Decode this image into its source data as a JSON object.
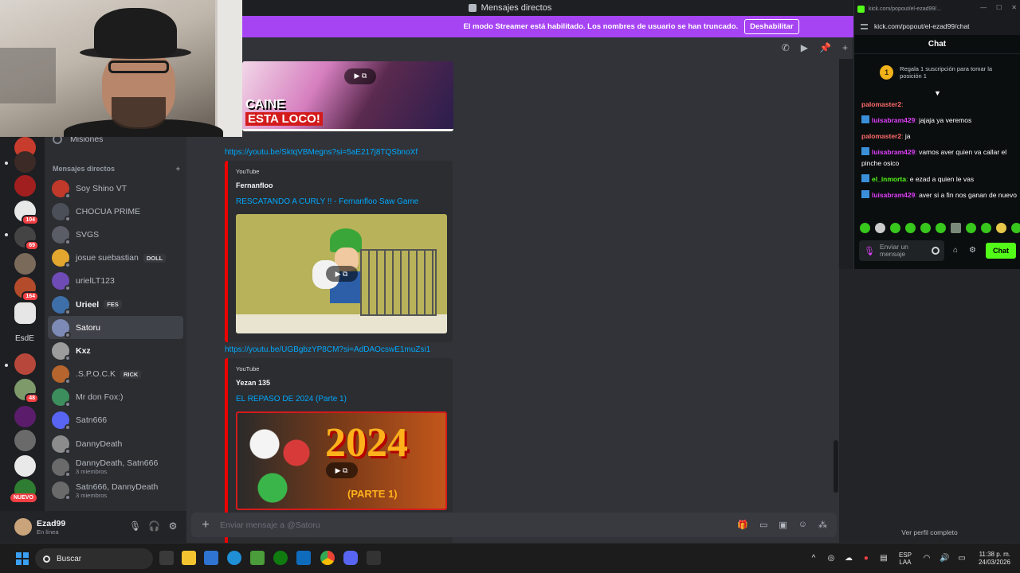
{
  "titlebar": {
    "title": "Mensajes directos"
  },
  "banner": {
    "text": "El modo Streamer está habilitado. Los nombres de usuario se han truncado.",
    "button": "Deshabilitar"
  },
  "rail": {
    "label": "EsdE",
    "badges": [
      "104",
      "69",
      "164",
      "48"
    ],
    "nuevo": "NUEVO"
  },
  "sidebar": {
    "misiones": "Misiones",
    "dm_header": "Mensajes directos",
    "add": "+",
    "items": [
      {
        "name": "Soy Shino VT",
        "tag": "",
        "sub": "",
        "color": "#c0392b"
      },
      {
        "name": "CHOCUA PRIME",
        "tag": "",
        "sub": "",
        "color": "#4b4f58"
      },
      {
        "name": "SVGS",
        "tag": "",
        "sub": "",
        "color": "#5a5d66"
      },
      {
        "name": "josue suebastian",
        "tag": "DOLL",
        "sub": "",
        "color": "#e3a72f"
      },
      {
        "name": "urielLT123",
        "tag": "",
        "sub": "",
        "color": "#6f4bb5"
      },
      {
        "name": "Urieel",
        "tag": "FES",
        "sub": "",
        "color": "#3f6fa8"
      },
      {
        "name": "Satoru",
        "tag": "",
        "sub": "",
        "color": "#7d8ab5"
      },
      {
        "name": "Kxz",
        "tag": "",
        "sub": "",
        "color": "#9c9c9c"
      },
      {
        "name": ".S.P.O.C.K",
        "tag": "RICK",
        "sub": "",
        "color": "#b5652d"
      },
      {
        "name": "Mr don Fox:)",
        "tag": "",
        "sub": "",
        "color": "#3c8e5c"
      },
      {
        "name": "Satn666",
        "tag": "",
        "sub": "",
        "color": "#5865f2"
      },
      {
        "name": "DannyDeath",
        "tag": "",
        "sub": "",
        "color": "#8c8c8c"
      },
      {
        "name": "DannyDeath, Satn666",
        "tag": "",
        "sub": "3 miembros",
        "color": "#6a6a6a"
      },
      {
        "name": "Satn666, DannyDeath",
        "tag": "",
        "sub": "3 miembros",
        "color": "#6a6a6a"
      }
    ],
    "active_index": 6
  },
  "user": {
    "name": "Ezad99",
    "status": "En línea"
  },
  "chat": {
    "link1": "https://youtu.be/SktqVBMegns?si=5aE217j8TQSbnoXf",
    "embed1": {
      "provider": "YouTube",
      "author": "Fernanfloo",
      "title": "RESCATANDO A CURLY !! - Fernanfloo Saw Game",
      "thumb_color": "#b8b25a"
    },
    "top_thumb": {
      "text1": "CAINE",
      "text2": "ESTA LOCO!"
    },
    "link2": "https://youtu.be/UGBgbzYP8CM?si=AdDAOcswE1muZsi1",
    "embed2": {
      "provider": "YouTube",
      "author": "Yezan 135",
      "title": "EL REPASO DE 2024 (Parte 1)",
      "big": "2024",
      "small": "(PARTE 1)"
    },
    "composer_placeholder": "Enviar mensaje a @Satoru"
  },
  "profile": {
    "link": "Ver perfil completo"
  },
  "kick": {
    "window_title": "kick.com/popout/el-ezad99/...",
    "url": "kick.com/popout/el-ezad99/chat",
    "header": "Chat",
    "gift_text": "Regala 1 suscripción para tomar la posición 1",
    "gift_rank": "1",
    "messages": [
      {
        "user": "palomaster2",
        "text": "",
        "color": "#ff6b6b",
        "badge": false
      },
      {
        "user": "luisabram429",
        "text": "jajaja ya veremos",
        "color": "#e040fb",
        "badge": true
      },
      {
        "user": "palomaster2",
        "text": "ja",
        "color": "#ff6b6b",
        "badge": false
      },
      {
        "user": "luisabram429",
        "text": "vamos aver quien va callar el pinche osico",
        "color": "#e040fb",
        "badge": true
      },
      {
        "user": "el_inmorta",
        "text": "e ezad a quien le vas",
        "color": "#53fc18",
        "badge": true
      },
      {
        "user": "luisabram429",
        "text": "aver si a fin nos ganan de nuevo",
        "color": "#e040fb",
        "badge": true
      }
    ],
    "send_placeholder": "Enviar un mensaje",
    "chat_button": "Chat"
  },
  "taskbar": {
    "search": "Buscar",
    "lang1": "ESP",
    "lang2": "LAA",
    "time": "11:38 p. m.",
    "date": "24/03/2026"
  }
}
